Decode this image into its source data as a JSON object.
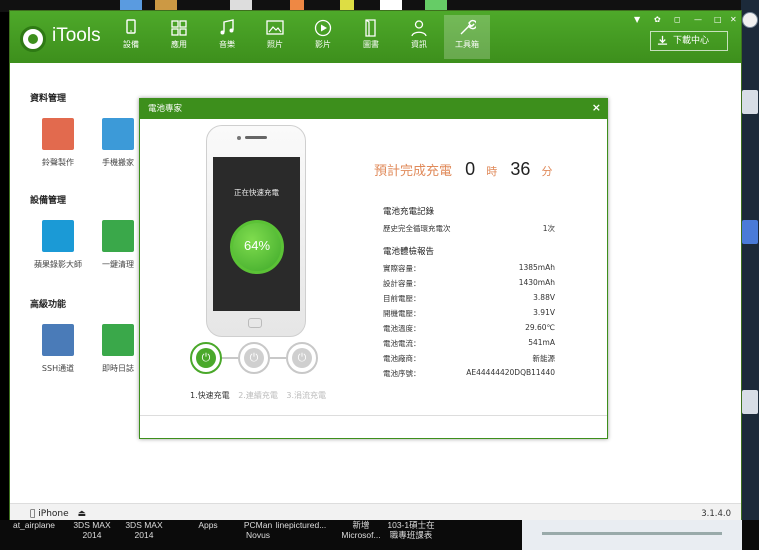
{
  "app": {
    "name": "iTools",
    "download_center": "下載中心",
    "version": "3.1.4.0"
  },
  "nav": [
    {
      "label": "設備",
      "icon": "device-icon"
    },
    {
      "label": "應用",
      "icon": "apps-icon"
    },
    {
      "label": "音樂",
      "icon": "music-icon"
    },
    {
      "label": "照片",
      "icon": "photo-icon"
    },
    {
      "label": "影片",
      "icon": "video-icon"
    },
    {
      "label": "圖書",
      "icon": "book-icon"
    },
    {
      "label": "資訊",
      "icon": "info-icon"
    },
    {
      "label": "工具箱",
      "icon": "toolbox-icon",
      "active": true
    }
  ],
  "sections": [
    {
      "title": "資料管理",
      "tools": [
        {
          "label": "鈴聲製作",
          "color": "#e26a4e"
        },
        {
          "label": "手機搬家",
          "color": "#3c9ad8"
        }
      ]
    },
    {
      "title": "設備管理",
      "tools": [
        {
          "label": "蘋果錄影大師",
          "color": "#1b9ad6"
        },
        {
          "label": "一鍵清理",
          "color": "#3aa84a"
        }
      ]
    },
    {
      "title": "高級功能",
      "tools": [
        {
          "label": "SSH通道",
          "color": "#4a7bb8"
        },
        {
          "label": "即時日誌",
          "color": "#3aa84a"
        }
      ]
    }
  ],
  "status": {
    "device": "iPhone"
  },
  "dialog": {
    "title": "電池專家",
    "phone_status": "正在快速充電",
    "percent": "64%",
    "percent_value": 64,
    "eta_label": "預計完成充電",
    "eta_hours": "0",
    "eta_hours_unit": "時",
    "eta_minutes": "36",
    "eta_minutes_unit": "分",
    "modes": [
      "1.快速充電",
      "2.連續充電",
      "3.涓流充電"
    ],
    "record_title": "電池充電記錄",
    "record": [
      {
        "k": "歷史完全循環充電次",
        "v": "1次"
      }
    ],
    "report_title": "電池體檢報告",
    "report": [
      {
        "k": "實際容量：",
        "v": "1385mAh"
      },
      {
        "k": "設計容量：",
        "v": "1430mAh"
      },
      {
        "k": "目前電壓：",
        "v": "3.88V"
      },
      {
        "k": "開機電壓：",
        "v": "3.91V"
      },
      {
        "k": "電池溫度：",
        "v": "29.60℃"
      },
      {
        "k": "電池電流：",
        "v": "541mA"
      },
      {
        "k": "電池廠商：",
        "v": "新能源"
      },
      {
        "k": "電池序號：",
        "v": "AE44444420DQB11440"
      }
    ]
  },
  "taskbar": [
    {
      "text": "at_airplane"
    },
    {
      "text": "3DS MAX\n2014"
    },
    {
      "text": "3DS MAX\n2014"
    },
    {
      "text": "Apps"
    },
    {
      "text": "PCMan\nNovus"
    },
    {
      "text": "linepictured..."
    },
    {
      "text": "新增\nMicrosof..."
    },
    {
      "text": "103-1碩士在\n職專班課表"
    }
  ]
}
